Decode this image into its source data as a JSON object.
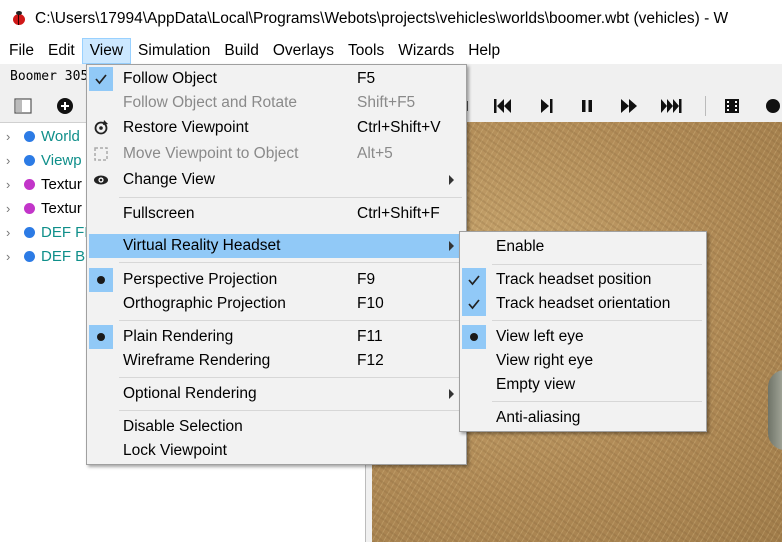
{
  "window": {
    "title": "C:\\Users\\17994\\AppData\\Local\\Programs\\Webots\\projects\\vehicles\\worlds\\boomer.wbt (vehicles) - W"
  },
  "menubar": {
    "items": [
      "File",
      "Edit",
      "View",
      "Simulation",
      "Build",
      "Overlays",
      "Tools",
      "Wizards",
      "Help"
    ],
    "open": "View"
  },
  "scene": {
    "title": "Boomer 305",
    "tree": [
      {
        "label": "World",
        "color": "#2c7be5",
        "label_color": "#0f8f8a"
      },
      {
        "label": "Viewp",
        "color": "#2c7be5",
        "label_color": "#0f8f8a"
      },
      {
        "label": "Textur",
        "color": "#c235c9",
        "label_color": "#000000"
      },
      {
        "label": "Textur",
        "color": "#c235c9",
        "label_color": "#000000"
      },
      {
        "label": "DEF FL",
        "color": "#2c7be5",
        "label_color": "#0f8f8a"
      },
      {
        "label": "DEF BC",
        "color": "#2c7be5",
        "label_color": "#0f8f8a"
      }
    ]
  },
  "view_menu": {
    "items": [
      {
        "label": "Follow Object",
        "shortcut": "F5",
        "marker": "check",
        "disabled": false
      },
      {
        "label": "Follow Object and Rotate",
        "shortcut": "Shift+F5",
        "marker": "none",
        "disabled": true
      },
      {
        "label": "Restore Viewpoint",
        "shortcut": "Ctrl+Shift+V",
        "marker": "restore-icon",
        "disabled": false
      },
      {
        "label": "Move Viewpoint to Object",
        "shortcut": "Alt+5",
        "marker": "move-icon",
        "disabled": true
      },
      {
        "label": "Change View",
        "shortcut": "",
        "marker": "eye-icon",
        "disabled": false,
        "submenu": true
      },
      {
        "label": "Fullscreen",
        "shortcut": "Ctrl+Shift+F",
        "marker": "none",
        "disabled": false
      },
      {
        "label": "Virtual Reality Headset",
        "shortcut": "",
        "marker": "none",
        "disabled": false,
        "submenu": true,
        "highlighted": true
      },
      {
        "label": "Perspective Projection",
        "shortcut": "F9",
        "marker": "radio",
        "disabled": false
      },
      {
        "label": "Orthographic Projection",
        "shortcut": "F10",
        "marker": "none",
        "disabled": false
      },
      {
        "label": "Plain Rendering",
        "shortcut": "F11",
        "marker": "radio",
        "disabled": false
      },
      {
        "label": "Wireframe Rendering",
        "shortcut": "F12",
        "marker": "none",
        "disabled": false
      },
      {
        "label": "Optional Rendering",
        "shortcut": "",
        "marker": "none",
        "disabled": false,
        "submenu": true
      },
      {
        "label": "Disable Selection",
        "shortcut": "",
        "marker": "none",
        "disabled": false
      },
      {
        "label": "Lock Viewpoint",
        "shortcut": "",
        "marker": "none",
        "disabled": false
      }
    ]
  },
  "vr_submenu": {
    "items": [
      {
        "label": "Enable",
        "marker": "none"
      },
      {
        "label": "Track headset position",
        "marker": "check"
      },
      {
        "label": "Track headset orientation",
        "marker": "check"
      },
      {
        "label": "View left eye",
        "marker": "radio"
      },
      {
        "label": "View right eye",
        "marker": "none"
      },
      {
        "label": "Empty view",
        "marker": "none"
      },
      {
        "label": "Anti-aliasing",
        "marker": "none"
      }
    ]
  },
  "colors": {
    "highlight": "#91c9f7",
    "menubar_open": "#cce8ff"
  }
}
